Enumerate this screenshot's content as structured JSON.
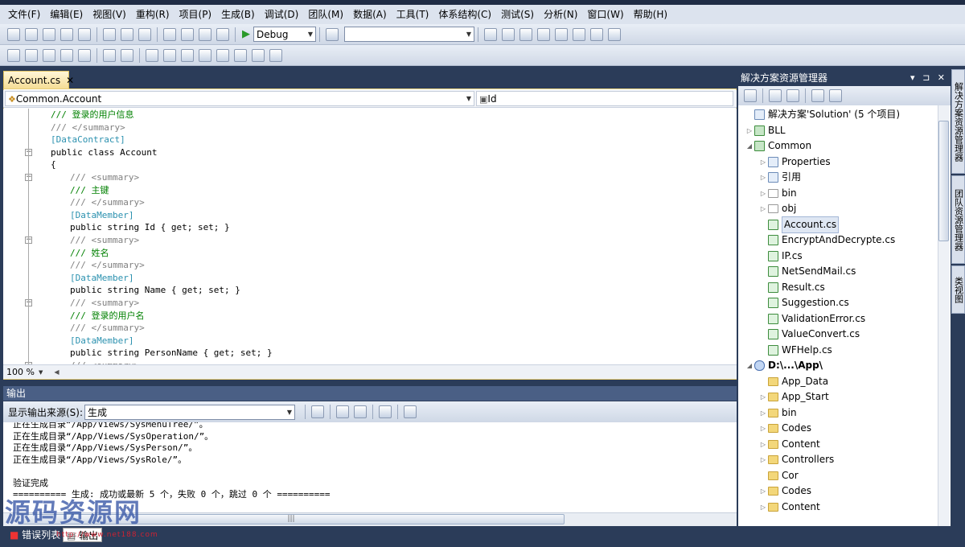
{
  "menu": [
    "文件(F)",
    "编辑(E)",
    "视图(V)",
    "重构(R)",
    "项目(P)",
    "生成(B)",
    "调试(D)",
    "团队(M)",
    "数据(A)",
    "工具(T)",
    "体系结构(C)",
    "测试(S)",
    "分析(N)",
    "窗口(W)",
    "帮助(H)"
  ],
  "toolbar": {
    "config_value": "Debug",
    "search_value": ""
  },
  "editor": {
    "tab_label": "Account.cs",
    "tab_close": "✕",
    "nav_left": "Common.Account",
    "nav_right": "Id",
    "zoom": "100 %",
    "lines": [
      {
        "text": "/// 登录的用户信息",
        "indent": 2,
        "kind": "cg"
      },
      {
        "text": "/// </summary>",
        "indent": 2,
        "kind": "cm"
      },
      {
        "text": "[DataContract]",
        "indent": 2,
        "kind": "ct"
      },
      {
        "text": "public class Account",
        "indent": 2,
        "kind": "ck"
      },
      {
        "text": "{",
        "indent": 2,
        "kind": "ck"
      },
      {
        "text": "/// <summary>",
        "indent": 3,
        "kind": "cm"
      },
      {
        "text": "/// 主键",
        "indent": 3,
        "kind": "cg"
      },
      {
        "text": "/// </summary>",
        "indent": 3,
        "kind": "cm"
      },
      {
        "text": "[DataMember]",
        "indent": 3,
        "kind": "ct"
      },
      {
        "text": "public string Id { get; set; }",
        "indent": 3,
        "kind": "ck"
      },
      {
        "text": "/// <summary>",
        "indent": 3,
        "kind": "cm"
      },
      {
        "text": "/// 姓名",
        "indent": 3,
        "kind": "cg"
      },
      {
        "text": "/// </summary>",
        "indent": 3,
        "kind": "cm"
      },
      {
        "text": "[DataMember]",
        "indent": 3,
        "kind": "ct"
      },
      {
        "text": "public string Name { get; set; }",
        "indent": 3,
        "kind": "ck"
      },
      {
        "text": "/// <summary>",
        "indent": 3,
        "kind": "cm"
      },
      {
        "text": "/// 登录的用户名",
        "indent": 3,
        "kind": "cg"
      },
      {
        "text": "/// </summary>",
        "indent": 3,
        "kind": "cm"
      },
      {
        "text": "[DataMember]",
        "indent": 3,
        "kind": "ct"
      },
      {
        "text": "public string PersonName { get; set; }",
        "indent": 3,
        "kind": "ck"
      },
      {
        "text": "/// <summary>",
        "indent": 3,
        "kind": "cm"
      }
    ]
  },
  "output": {
    "title": "输出",
    "source_label": "显示输出来源(S):",
    "source_value": "生成",
    "lines": [
      "正在生成目录“/App/Views/SysMenuTree/”。",
      "正在生成目录“/App/Views/SysOperation/”。",
      "正在生成目录“/App/Views/SysPerson/”。",
      "正在生成目录“/App/Views/SysRole/”。",
      "",
      "验证完成",
      "========== 生成: 成功或最新 5 个，失败 0 个，跳过 0 个 =========="
    ]
  },
  "bottom_tabs": [
    "错误列表",
    "输出"
  ],
  "watermark": {
    "text": "源码资源网",
    "url": "http://www.net188.com"
  },
  "solution_explorer": {
    "title": "解决方案资源管理器",
    "controls": "▾ ⊐ ✕",
    "items": [
      {
        "label": "解决方案'Solution' (5 个项目)",
        "level": 0,
        "icon": "solution",
        "expander": ""
      },
      {
        "label": "BLL",
        "level": 0,
        "icon": "proj",
        "expander": "▷"
      },
      {
        "label": "Common",
        "level": 0,
        "icon": "proj",
        "expander": "◢"
      },
      {
        "label": "Properties",
        "level": 1,
        "icon": "properties",
        "expander": "▷"
      },
      {
        "label": "引用",
        "level": 1,
        "icon": "references",
        "expander": "▷"
      },
      {
        "label": "bin",
        "level": 1,
        "icon": "folder-w",
        "expander": "▷"
      },
      {
        "label": "obj",
        "level": 1,
        "icon": "folder-w",
        "expander": "▷"
      },
      {
        "label": "Account.cs",
        "level": 1,
        "icon": "cs",
        "expander": "",
        "selected": true
      },
      {
        "label": "EncryptAndDecrypte.cs",
        "level": 1,
        "icon": "cs",
        "expander": ""
      },
      {
        "label": "IP.cs",
        "level": 1,
        "icon": "cs",
        "expander": ""
      },
      {
        "label": "NetSendMail.cs",
        "level": 1,
        "icon": "cs",
        "expander": ""
      },
      {
        "label": "Result.cs",
        "level": 1,
        "icon": "cs",
        "expander": ""
      },
      {
        "label": "Suggestion.cs",
        "level": 1,
        "icon": "cs",
        "expander": ""
      },
      {
        "label": "ValidationError.cs",
        "level": 1,
        "icon": "cs",
        "expander": ""
      },
      {
        "label": "ValueConvert.cs",
        "level": 1,
        "icon": "cs",
        "expander": ""
      },
      {
        "label": "WFHelp.cs",
        "level": 1,
        "icon": "cs",
        "expander": ""
      },
      {
        "label": "D:\\...\\App\\",
        "level": 0,
        "icon": "web",
        "expander": "◢",
        "bold": true
      },
      {
        "label": "App_Data",
        "level": 1,
        "icon": "folder",
        "expander": ""
      },
      {
        "label": "App_Start",
        "level": 1,
        "icon": "folder",
        "expander": "▷"
      },
      {
        "label": "bin",
        "level": 1,
        "icon": "folder",
        "expander": "▷"
      },
      {
        "label": "Codes",
        "level": 1,
        "icon": "folder",
        "expander": "▷"
      },
      {
        "label": "Content",
        "level": 1,
        "icon": "folder",
        "expander": "▷"
      },
      {
        "label": "Controllers",
        "level": 1,
        "icon": "folder",
        "expander": "▷"
      },
      {
        "label": "Cor",
        "level": 1,
        "icon": "folder",
        "expander": ""
      },
      {
        "label": "Codes",
        "level": 1,
        "icon": "folder",
        "expander": "▷"
      },
      {
        "label": "Content",
        "level": 1,
        "icon": "folder",
        "expander": "▷"
      }
    ]
  },
  "side_tabs": [
    "解决方案资源管理器",
    "团队资源管理器",
    "类视图"
  ],
  "colors": {
    "chrome": "#2b3c59",
    "active_tab": "#f5dd95",
    "comment": "#808080",
    "xml_green": "#008000",
    "type": "#2b91af"
  }
}
